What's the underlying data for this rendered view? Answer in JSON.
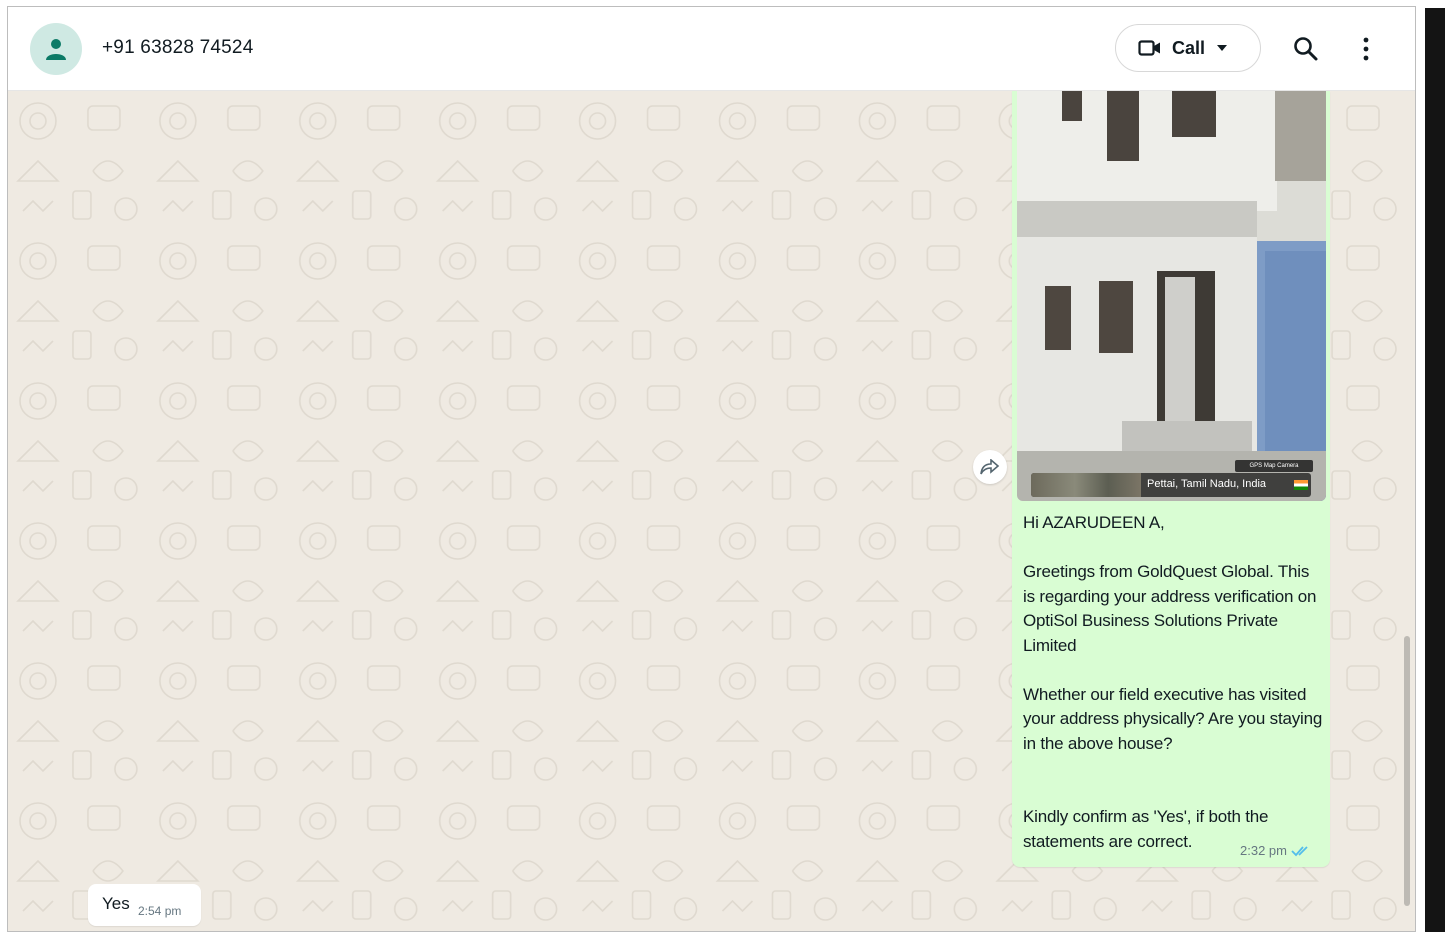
{
  "header": {
    "contact_name": "+91 63828 74524",
    "call_label": "Call",
    "icons": {
      "avatar": "person-icon",
      "call": "video-camera-icon",
      "call_dropdown": "caret-down-icon",
      "search": "search-icon",
      "menu": "more-vertical-icon"
    }
  },
  "messages": {
    "outgoing": {
      "photo_caption": "Pettai, Tamil Nadu, India",
      "photo_badge": "GPS Map Camera",
      "text": "Hi AZARUDEEN A,\n\nGreetings from GoldQuest Global. This is regarding your address verification on OptiSol Business Solutions Private Limited\n\nWhether our field executive has visited your address physically? Are you staying in the above house?\n\n\nKindly confirm as 'Yes', if both the statements are correct.",
      "time": "2:32 pm",
      "status_icon": "double-check-read-icon"
    },
    "incoming": {
      "text": "Yes",
      "time": "2:54 pm"
    }
  },
  "colors": {
    "chat_background": "#efeae2",
    "outgoing_bubble": "#d9fdd3",
    "incoming_bubble": "#ffffff",
    "avatar_background": "#cfe9e3",
    "avatar_icon": "#0b7a66",
    "read_tick": "#53bdeb"
  }
}
